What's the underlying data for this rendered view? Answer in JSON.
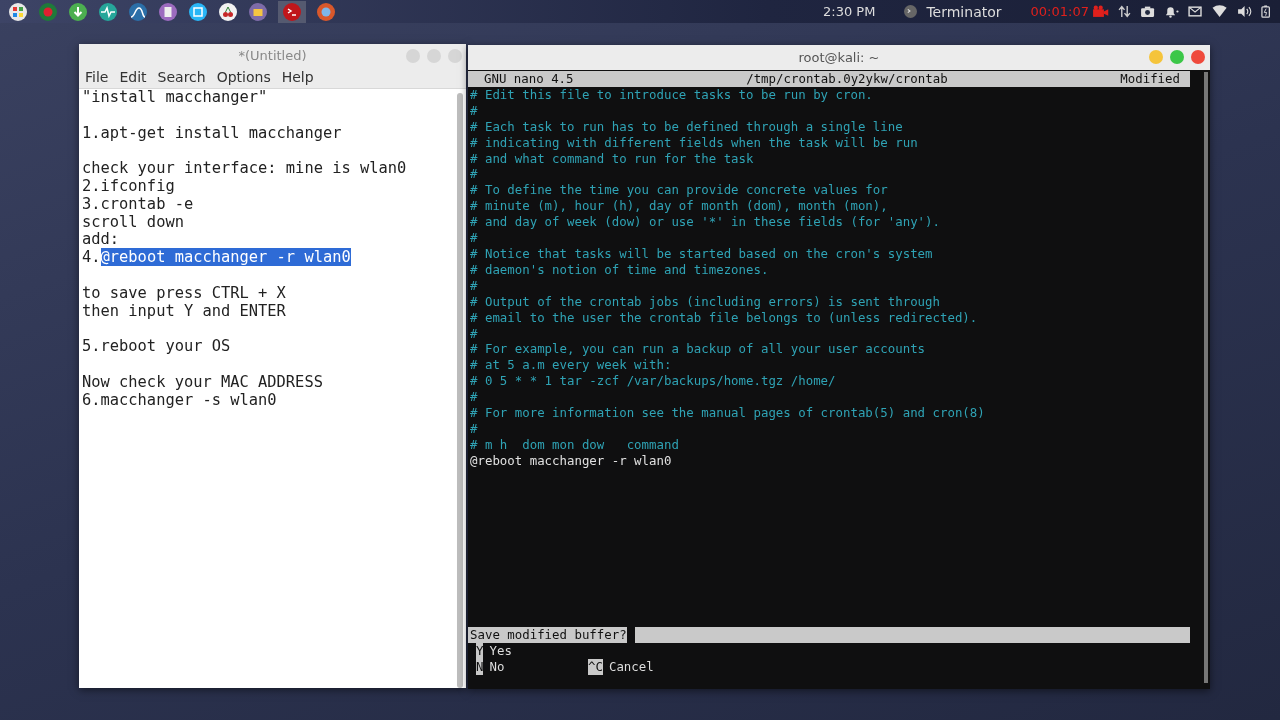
{
  "top_panel": {
    "clock": "2:30 PM",
    "active_app": "Terminator",
    "recording_time": "00:01:07"
  },
  "editor": {
    "title": "*(Untitled)",
    "menu": [
      "File",
      "Edit",
      "Search",
      "Options",
      "Help"
    ],
    "paragraphs": [
      [
        {
          "text": "\"install macchanger\""
        }
      ],
      [
        {
          "text": "1.apt-get install macchanger"
        }
      ],
      [
        {
          "text": "check your interface: mine is wlan0"
        },
        {
          "text": "2.ifconfig"
        },
        {
          "text": "3.crontab -e"
        },
        {
          "text": "scroll down"
        },
        {
          "text": "add:"
        },
        {
          "text": "4.",
          "selected_text": "@reboot macchanger -r wlan0"
        }
      ],
      [
        {
          "text": "to save press CTRL + X"
        },
        {
          "text": "then input Y and ENTER"
        }
      ],
      [
        {
          "text": "5.reboot your OS"
        }
      ],
      [
        {
          "text": "Now check your MAC ADDRESS"
        },
        {
          "text": "6.macchanger -s wlan0"
        }
      ]
    ]
  },
  "terminal": {
    "title": "root@kali: ~",
    "nano_header": {
      "version": "GNU nano 4.5",
      "file": "/tmp/crontab.0y2ykw/crontab",
      "status": "Modified"
    },
    "lines": [
      {
        "kind": "comment",
        "text": "# Edit this file to introduce tasks to be run by cron."
      },
      {
        "kind": "comment",
        "text": "#"
      },
      {
        "kind": "comment",
        "text": "# Each task to run has to be defined through a single line"
      },
      {
        "kind": "comment",
        "text": "# indicating with different fields when the task will be run"
      },
      {
        "kind": "comment",
        "text": "# and what command to run for the task"
      },
      {
        "kind": "comment",
        "text": "#"
      },
      {
        "kind": "comment",
        "text": "# To define the time you can provide concrete values for"
      },
      {
        "kind": "comment",
        "text": "# minute (m), hour (h), day of month (dom), month (mon),"
      },
      {
        "kind": "comment",
        "text": "# and day of week (dow) or use '*' in these fields (for 'any')."
      },
      {
        "kind": "comment",
        "text": "#"
      },
      {
        "kind": "comment",
        "text": "# Notice that tasks will be started based on the cron's system"
      },
      {
        "kind": "comment",
        "text": "# daemon's notion of time and timezones."
      },
      {
        "kind": "comment",
        "text": "#"
      },
      {
        "kind": "comment",
        "text": "# Output of the crontab jobs (including errors) is sent through"
      },
      {
        "kind": "comment",
        "text": "# email to the user the crontab file belongs to (unless redirected)."
      },
      {
        "kind": "comment",
        "text": "#"
      },
      {
        "kind": "comment",
        "text": "# For example, you can run a backup of all your user accounts"
      },
      {
        "kind": "comment",
        "text": "# at 5 a.m every week with:"
      },
      {
        "kind": "comment",
        "text": "# 0 5 * * 1 tar -zcf /var/backups/home.tgz /home/"
      },
      {
        "kind": "comment",
        "text": "#"
      },
      {
        "kind": "comment",
        "text": "# For more information see the manual pages of crontab(5) and cron(8)"
      },
      {
        "kind": "comment",
        "text": "#"
      },
      {
        "kind": "comment",
        "text": "# m h  dom mon dow   command"
      },
      {
        "kind": "code",
        "text": "@reboot macchanger -r wlan0"
      }
    ],
    "prompt": "Save modified buffer?",
    "options": [
      [
        {
          "key": "Y",
          "label": "Yes"
        }
      ],
      [
        {
          "key": "N",
          "label": "No"
        },
        {
          "key": "^C",
          "label": "Cancel"
        }
      ]
    ]
  }
}
